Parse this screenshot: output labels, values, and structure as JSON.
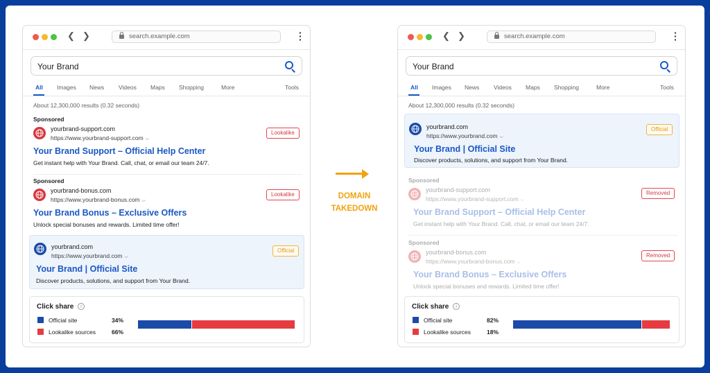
{
  "browser": {
    "url": "search.example.com",
    "query": "Your Brand",
    "tabs": [
      "All",
      "Images",
      "News",
      "Videos",
      "Maps",
      "Shopping",
      "More"
    ],
    "tools_label": "Tools",
    "results_count": "About 12,300,000 results (0.32 seconds)"
  },
  "callout": {
    "line1": "DOMAIN",
    "line2": "TAKEDOWN"
  },
  "results": {
    "support": {
      "sponsored": "Sponsored",
      "domain": "yourbrand-support.com",
      "url": "https://www.yourbrand-support.com",
      "title": "Your Brand Support – Official Help Center",
      "desc": "Get instant help with Your Brand. Call, chat, or email our team 24/7."
    },
    "bonus": {
      "sponsored": "Sponsored",
      "domain": "yourbrand-bonus.com",
      "url": "https://www.yourbrand-bonus.com",
      "title": "Your Brand Bonus – Exclusive Offers",
      "desc": "Unlock special bonuses and rewards. Limited time offer!"
    },
    "official": {
      "domain": "yourbrand.com",
      "url": "https://www.yourbrand.com",
      "title": "Your Brand | Official Site",
      "desc": "Discover products, solutions, and support from Your Brand."
    }
  },
  "badges": {
    "lookalike": "Lookalike",
    "official": "Official",
    "removed": "Removed"
  },
  "click_share": {
    "title": "Click share",
    "official_label": "Official site",
    "lookalike_label": "Lookalike sources",
    "before": {
      "official_pct": "34%",
      "lookalike_pct": "66%",
      "official": 34,
      "lookalike": 66
    },
    "after": {
      "official_pct": "82%",
      "lookalike_pct": "18%",
      "official": 82,
      "lookalike": 18
    }
  },
  "colors": {
    "background": "#0a3e9c",
    "link_blue": "#1a57c4",
    "official_blue": "#1b4aa8",
    "lookalike_red": "#e53b41",
    "accent_orange": "#f2a20c"
  }
}
